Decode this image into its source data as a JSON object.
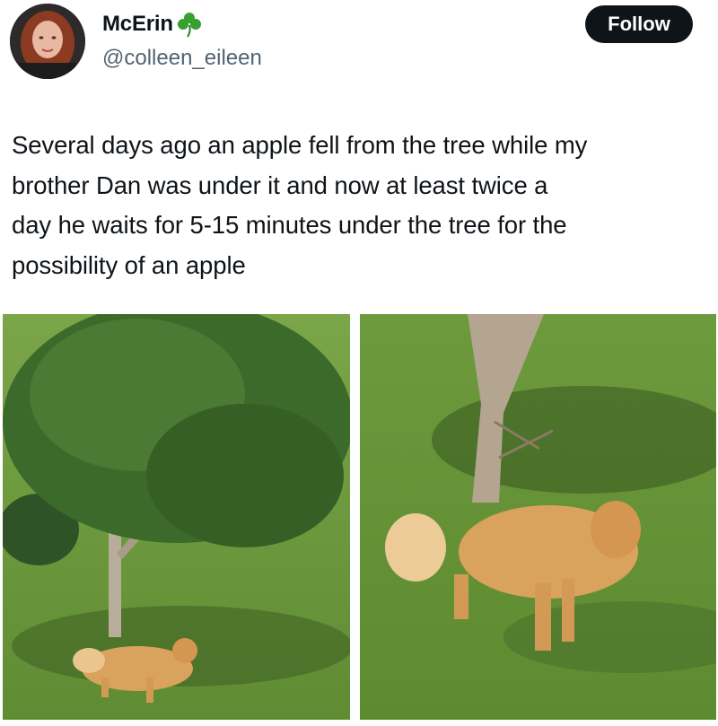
{
  "user": {
    "display_name": "McErin",
    "badge_icon": "shamrock-icon",
    "handle": "@colleen_eileen"
  },
  "follow_label": "Follow",
  "tweet": {
    "lines": [
      "Several days ago an apple fell from the tree while my",
      "brother Dan was under it and now at least twice a",
      "day he waits for 5-15 minutes under the tree for the",
      "possibility of an apple"
    ]
  },
  "media": [
    {
      "kind": "photo"
    },
    {
      "kind": "photo"
    }
  ],
  "colors": {
    "text": "#0f1419",
    "secondary": "#536471",
    "follow_bg": "#0f1419",
    "grass": "#6f9a3c",
    "foliage": "#3e6b2a",
    "dog": "#d9a25d"
  }
}
